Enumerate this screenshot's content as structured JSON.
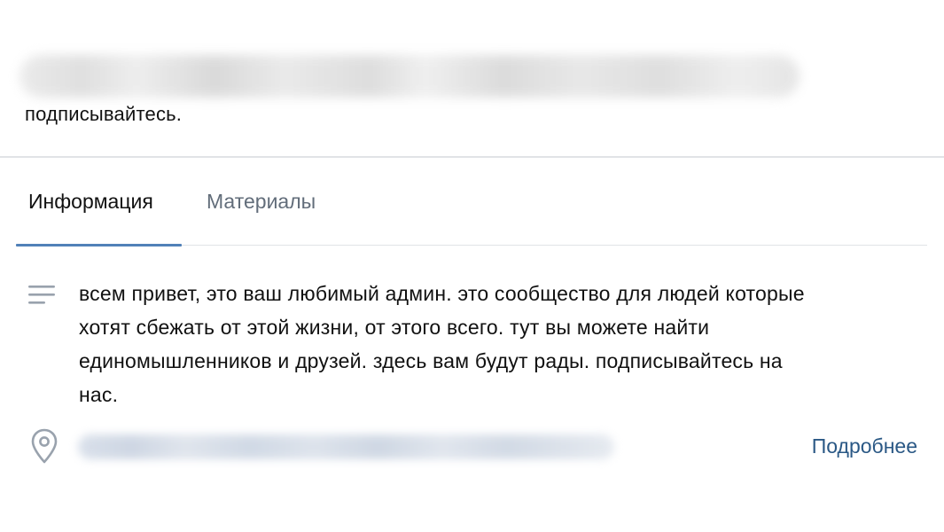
{
  "header": {
    "status_tail": "подписывайтесь."
  },
  "tabs": [
    {
      "label": "Информация",
      "active": true
    },
    {
      "label": "Материалы",
      "active": false
    }
  ],
  "info": {
    "description_icon": "description-lines-icon",
    "description_lines": [
      "всем привет, это ваш любимый админ. это сообщество для людей которые",
      "хотят сбежать от этой жизни, от этого всего. тут вы можете найти",
      "единомышленников и друзей. здесь вам будут рады. подписывайтесь на",
      "нас."
    ],
    "location_icon": "map-pin-icon",
    "more_label": "Подробнее"
  },
  "colors": {
    "accent": "#5181b8",
    "link": "#2a5885",
    "muted_text": "#626d7a",
    "divider": "#e1e3e6"
  }
}
